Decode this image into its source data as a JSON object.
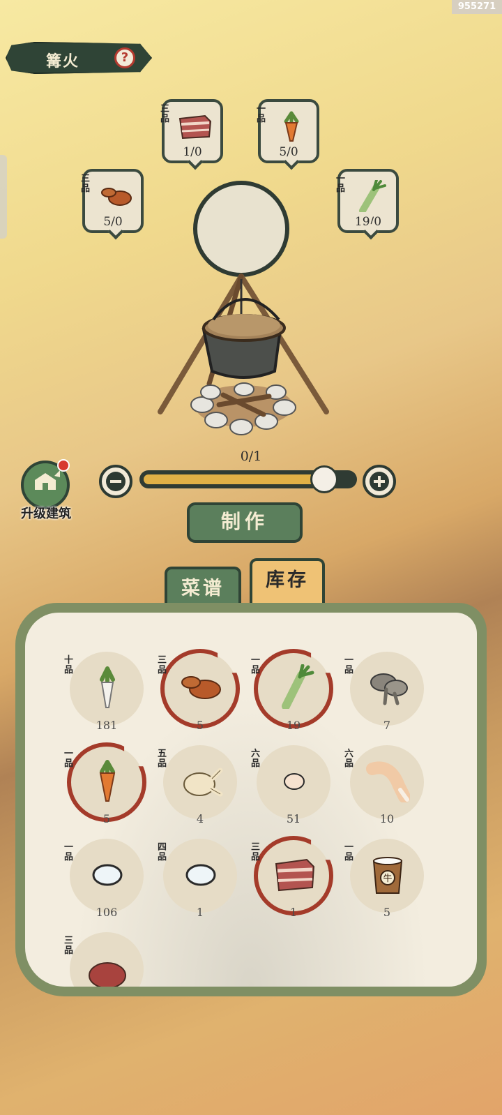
{
  "watermark": "955271",
  "header": {
    "title": "篝火",
    "help_icon": "?"
  },
  "slots": [
    {
      "grade": "三品",
      "count": "1/0",
      "icon": "pork-belly"
    },
    {
      "grade": "一品",
      "count": "5/0",
      "icon": "carrot"
    },
    {
      "grade": "三品",
      "count": "5/0",
      "icon": "chicken-wing"
    },
    {
      "grade": "一品",
      "count": "19/0",
      "icon": "leek"
    }
  ],
  "progress": "0/1",
  "controls": {
    "upgrade_label": "升级建筑",
    "make_label": "制作",
    "slider_fraction": 0.9
  },
  "tabs": {
    "recipe": "菜谱",
    "stock": "库存"
  },
  "inventory": [
    {
      "grade": "十品",
      "count": "181",
      "icon": "radish"
    },
    {
      "grade": "三品",
      "count": "5",
      "icon": "chicken-wing",
      "selected": true
    },
    {
      "grade": "一品",
      "count": "19",
      "icon": "leek",
      "selected": true
    },
    {
      "grade": "一品",
      "count": "7",
      "icon": "mushroom"
    },
    {
      "grade": "一品",
      "count": "5",
      "icon": "carrot",
      "selected": true
    },
    {
      "grade": "五品",
      "count": "4",
      "icon": "whole-chicken"
    },
    {
      "grade": "六品",
      "count": "51",
      "icon": "egg"
    },
    {
      "grade": "六品",
      "count": "10",
      "icon": "chicken-leg"
    },
    {
      "grade": "一品",
      "count": "106",
      "icon": "white-egg"
    },
    {
      "grade": "四品",
      "count": "1",
      "icon": "white-egg"
    },
    {
      "grade": "三品",
      "count": "1",
      "icon": "pork-belly",
      "selected": true
    },
    {
      "grade": "一品",
      "count": "5",
      "icon": "milk-bucket",
      "bucket_label": "牛"
    },
    {
      "grade": "三品",
      "count": "",
      "icon": "steak"
    }
  ],
  "colors": {
    "dark_green": "#2f4436",
    "accent_red": "#a43b2a",
    "button_green": "#5b7f5c",
    "tab_orange": "#efc275"
  }
}
